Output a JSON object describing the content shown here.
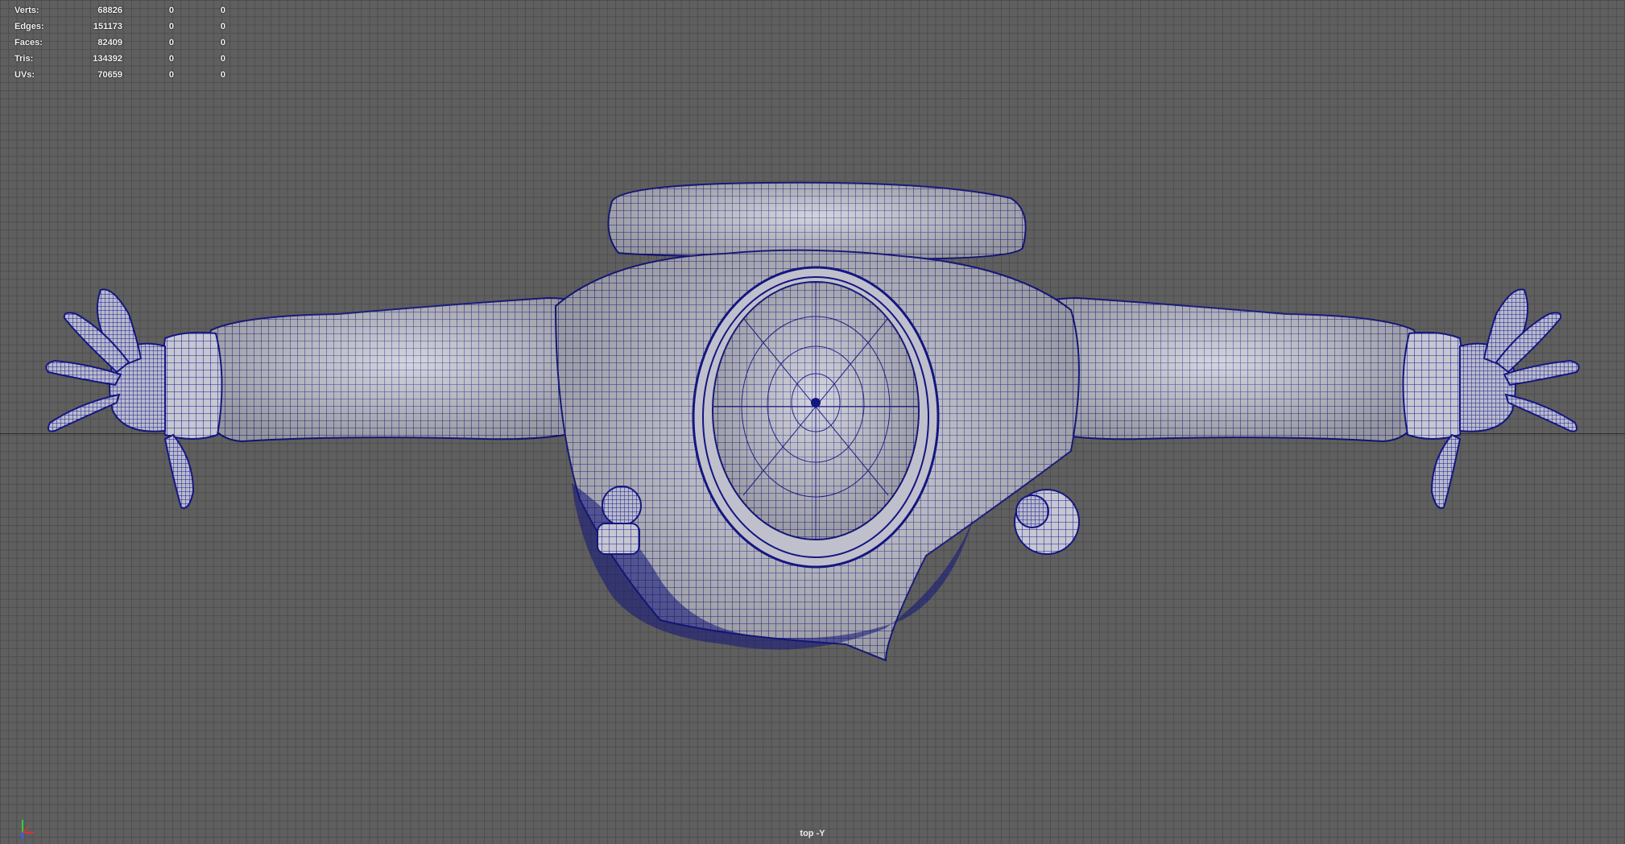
{
  "viewport": {
    "camera_label": "top -Y",
    "background": "#5f5f5f",
    "grid_color": "#4e4e4e",
    "wire_color": "#1a1a8c",
    "mesh_fill": "#c7c8d2"
  },
  "hud": {
    "rows": [
      {
        "label": "Verts:",
        "value": "68826",
        "sel": "0",
        "comp": "0"
      },
      {
        "label": "Edges:",
        "value": "151173",
        "sel": "0",
        "comp": "0"
      },
      {
        "label": "Faces:",
        "value": "82409",
        "sel": "0",
        "comp": "0"
      },
      {
        "label": "Tris:",
        "value": "134392",
        "sel": "0",
        "comp": "0"
      },
      {
        "label": "UVs:",
        "value": "70659",
        "sel": "0",
        "comp": "0"
      }
    ]
  },
  "axis_gizmo": {
    "x_color": "#e03030",
    "y_color": "#30d030",
    "z_color": "#3060ff"
  }
}
